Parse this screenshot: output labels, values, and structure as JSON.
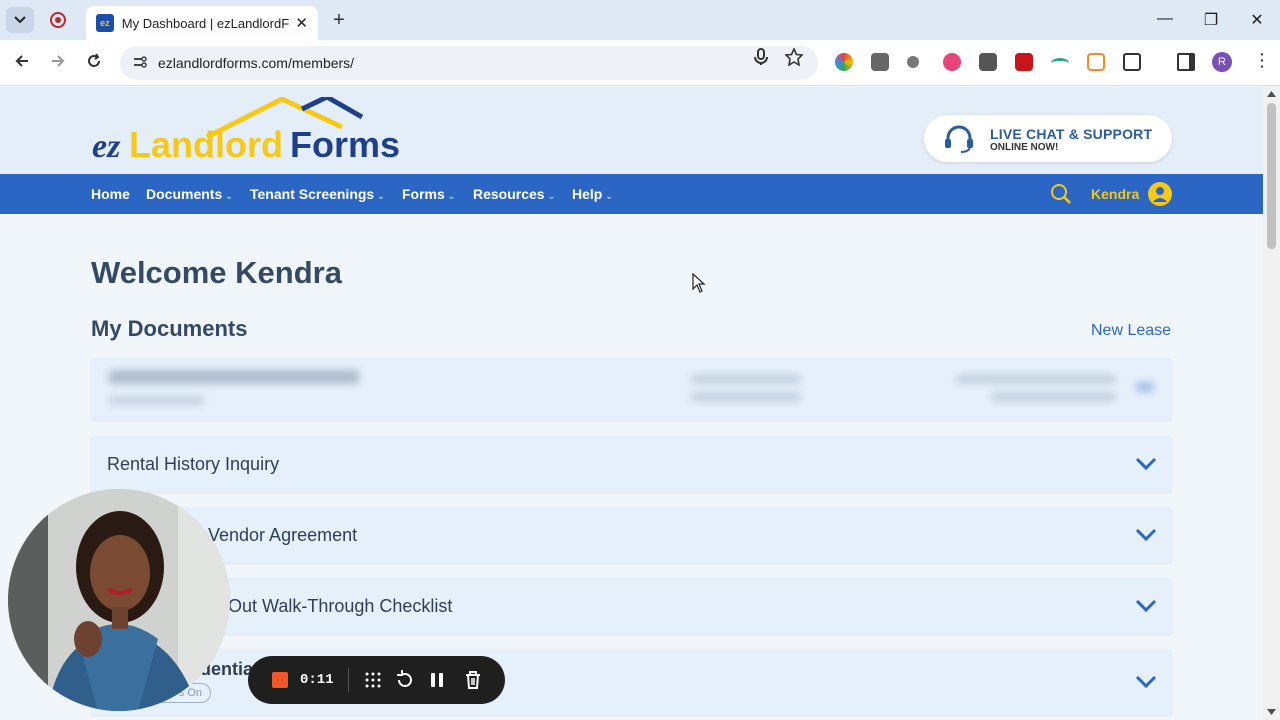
{
  "browser": {
    "tab_title": "My Dashboard | ezLandlordForms",
    "url": "ezlandlordforms.com/members/",
    "new_tab": "+",
    "tab_close": "✕",
    "win_minimize": "—",
    "win_restore": "❐",
    "win_close": "✕",
    "profile_initial": "R"
  },
  "site": {
    "logo_ez": "ez",
    "logo_landlord": "Landlord",
    "logo_forms": "Forms",
    "chat_title": "LIVE CHAT & SUPPORT",
    "chat_status": "ONLINE NOW!",
    "menu": [
      {
        "label": "Home",
        "chevron": ""
      },
      {
        "label": "Documents",
        "chevron": "⌄"
      },
      {
        "label": "Tenant Screenings",
        "chevron": "⌄"
      },
      {
        "label": "Forms",
        "chevron": "⌄"
      },
      {
        "label": "Resources",
        "chevron": "⌄"
      },
      {
        "label": "Help",
        "chevron": "⌄"
      }
    ],
    "user_name": "Kendra"
  },
  "main": {
    "welcome": "Welcome Kendra",
    "section_title": "My Documents",
    "new_lease": "New Lease",
    "documents": [
      {
        "title": "Rental History Inquiry"
      },
      {
        "title": "Vendor Agreement"
      },
      {
        "title": "Out Walk-Through Checklist"
      },
      {
        "title": "dentia"
      }
    ],
    "partial_badge": "s On"
  },
  "recorder": {
    "time": "0:11"
  },
  "colors": {
    "brand_blue": "#2b66c4",
    "brand_yellow": "#f7c916",
    "heading": "#344a64",
    "record_red": "#f0572b"
  }
}
